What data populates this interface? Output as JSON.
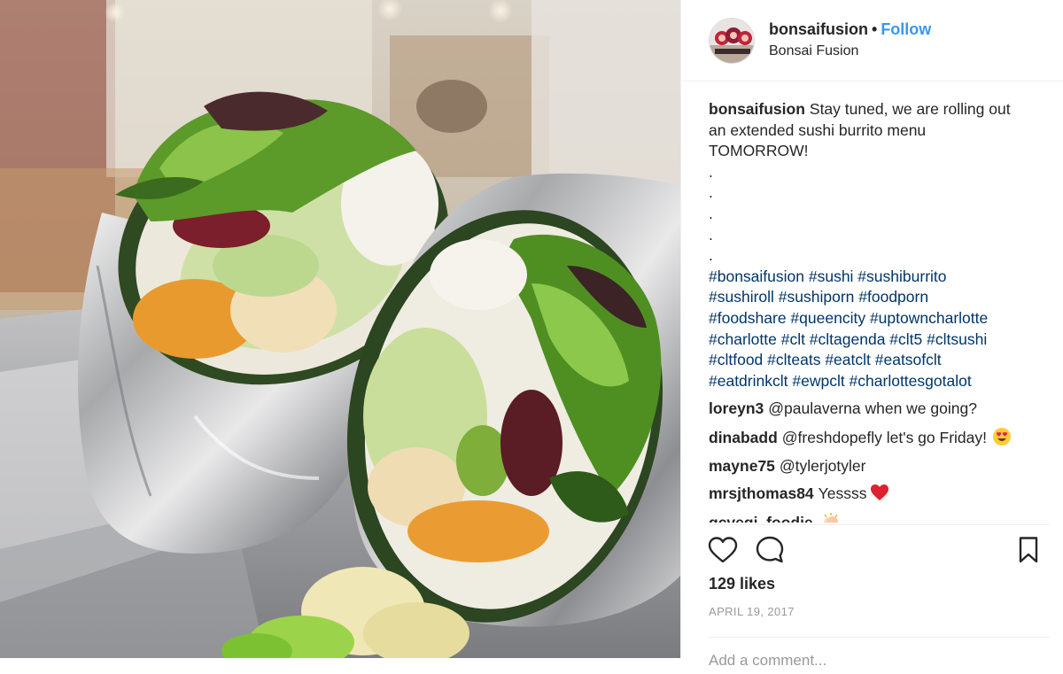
{
  "post": {
    "username": "bonsaifusion",
    "separator": "•",
    "follow_label": "Follow",
    "location": "Bonsai Fusion"
  },
  "caption": {
    "username": "bonsaifusion",
    "line1": "Stay tuned, we are rolling out",
    "line2": "an extended sushi burrito menu",
    "line3": "TOMORROW!",
    "dots": [
      ".",
      ".",
      ".",
      ".",
      "."
    ],
    "hashtag_lines": [
      "#bonsaifusion #sushi #sushiburrito",
      "#sushiroll #sushiporn #foodporn",
      "#foodshare #queencity #uptowncharlotte",
      "#charlotte #clt #cltagenda #clt5 #cltsushi",
      "#cltfood #clteats #eatclt #eatsofclt",
      "#eatdrinkclt #ewpclt #charlottesgotalot"
    ]
  },
  "comments": [
    {
      "user": "loreyn3",
      "text": "@paulaverna when we going?",
      "emoji": ""
    },
    {
      "user": "dinabadd",
      "text": "@freshdopefly let's go Friday!",
      "emoji": "heart-eyes-emoji"
    },
    {
      "user": "mayne75",
      "text": "@tylerjotyler",
      "emoji": ""
    },
    {
      "user": "mrsjthomas84",
      "text": "Yessss",
      "emoji": "red-heart-emoji"
    },
    {
      "user": "gcvegi_foodie",
      "text": "",
      "emoji": "clapping-hands-emoji"
    }
  ],
  "actions": {
    "like_icon": "heart-outline-icon",
    "comment_icon": "comment-bubble-icon",
    "save_icon": "bookmark-icon"
  },
  "likes": "129 likes",
  "date": "APRIL 19, 2017",
  "add_comment_placeholder": "Add a comment...",
  "colors": {
    "link_blue": "#3897f0",
    "hashtag": "#003569",
    "text": "#262626",
    "muted": "#999999",
    "divider": "#efefef"
  }
}
